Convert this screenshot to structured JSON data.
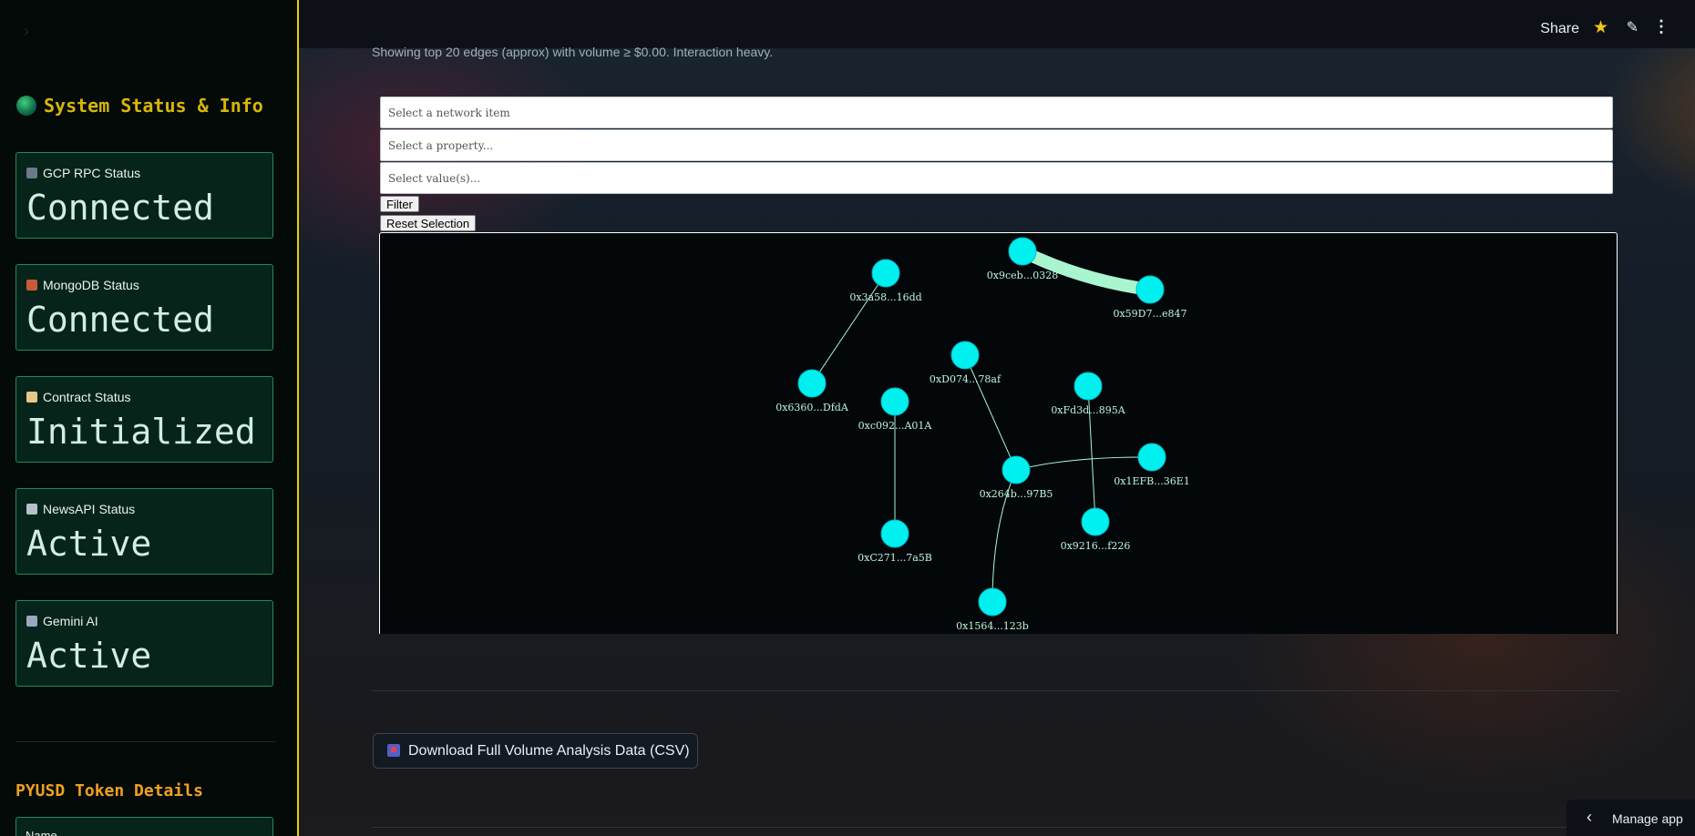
{
  "sidebar": {
    "title": "System Status & Info",
    "cards": [
      {
        "label": "GCP RPC Status",
        "value": "Connected",
        "icon": "satellite-icon"
      },
      {
        "label": "MongoDB Status",
        "value": "Connected",
        "icon": "brick-icon"
      },
      {
        "label": "Contract Status",
        "value": "Initialized",
        "icon": "scroll-icon"
      },
      {
        "label": "NewsAPI Status",
        "value": "Active",
        "icon": "newspaper-icon"
      },
      {
        "label": "Gemini AI",
        "value": "Active",
        "icon": "robot-icon"
      }
    ],
    "token_title": "PYUSD Token Details",
    "token_name_label": "Name"
  },
  "header": {
    "share": "Share"
  },
  "main": {
    "caption": "Showing top 20 edges (approx) with volume ≥ $0.00. Interaction heavy.",
    "select_network_placeholder": "Select a network item",
    "select_property_placeholder": "Select a property...",
    "select_value_placeholder": "Select value(s)...",
    "filter_label": "Filter",
    "reset_label": "Reset Selection",
    "download_label": "Download Full Volume Analysis Data (CSV)",
    "manage_label": "Manage app"
  },
  "graph": {
    "node_color": "#00f0f0",
    "edge_color": "#a8f5d0",
    "label_color": "#bff5e0",
    "nodes": [
      {
        "id": "0x9ceb...0328"
      },
      {
        "id": "0x59D7...e847"
      },
      {
        "id": "0x3a58...16dd"
      },
      {
        "id": "0x6360...DfdA"
      },
      {
        "id": "0xc092...A01A"
      },
      {
        "id": "0xC271...7a5B"
      },
      {
        "id": "0xD074...78af"
      },
      {
        "id": "0x264b...97B5"
      },
      {
        "id": "0x1564...123b"
      },
      {
        "id": "0x1EFB...36E1"
      },
      {
        "id": "0xFd3d...895A"
      },
      {
        "id": "0x9216...f226"
      }
    ],
    "edges": [
      {
        "source": "0x9ceb...0328",
        "target": "0x59D7...e847",
        "weight": 10
      },
      {
        "source": "0x3a58...16dd",
        "target": "0x6360...DfdA",
        "weight": 1
      },
      {
        "source": "0xc092...A01A",
        "target": "0xC271...7a5B",
        "weight": 1
      },
      {
        "source": "0xD074...78af",
        "target": "0x264b...97B5",
        "weight": 1
      },
      {
        "source": "0x264b...97B5",
        "target": "0x1564...123b",
        "weight": 1
      },
      {
        "source": "0x264b...97B5",
        "target": "0x1EFB...36E1",
        "weight": 1
      },
      {
        "source": "0xFd3d...895A",
        "target": "0x9216...f226",
        "weight": 1
      }
    ]
  }
}
